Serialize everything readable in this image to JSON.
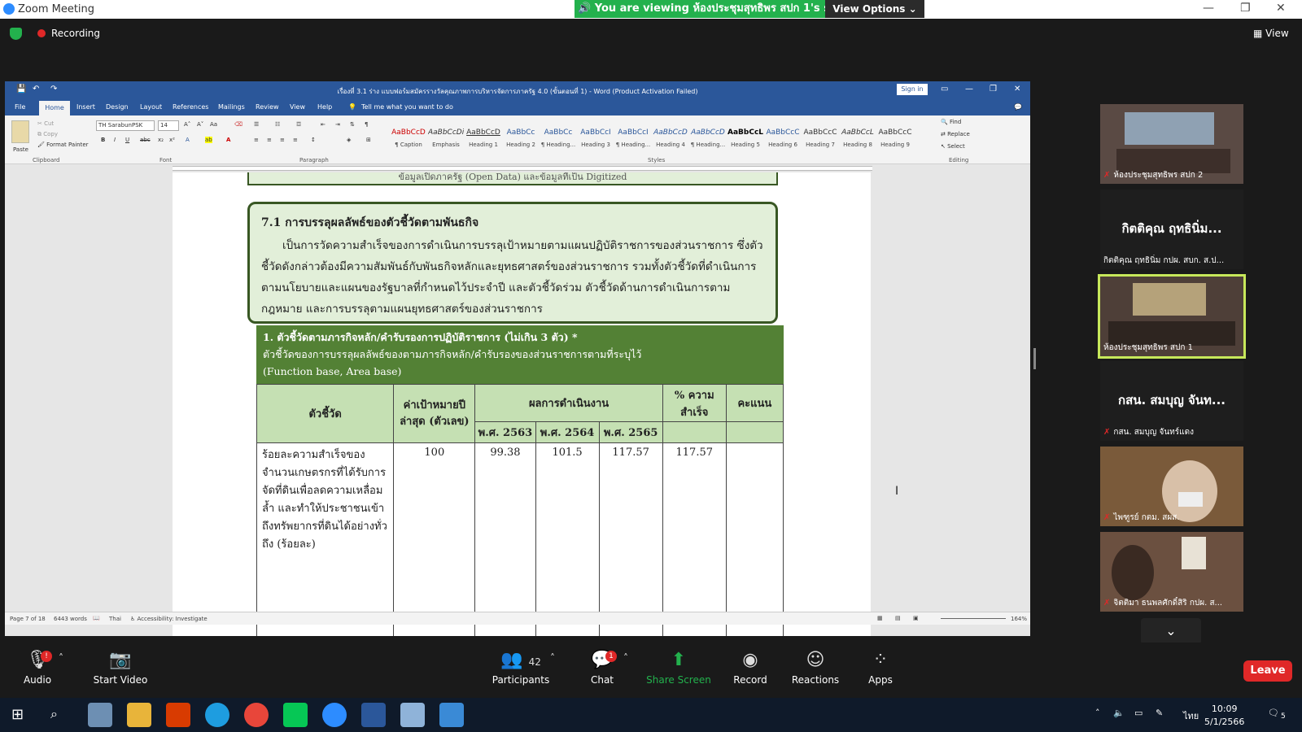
{
  "zoom": {
    "window_title": "Zoom Meeting",
    "viewing_banner": "You are viewing ห้องประชุมสุทธิพร สปก 1's screen",
    "view_options": "View Options",
    "recording": "Recording",
    "view_button": "View"
  },
  "word": {
    "title": "เรื่องที่ 3.1 ร่าง แบบฟอร์มสมัครรางวัลคุณภาพการบริหารจัดการภาครัฐ 4.0 (ขั้นตอนที่ 1) - Word (Product Activation Failed)",
    "sign_in": "Sign in",
    "tabs": [
      "File",
      "Home",
      "Insert",
      "Design",
      "Layout",
      "References",
      "Mailings",
      "Review",
      "View",
      "Help"
    ],
    "tell_me": "Tell me what you want to do",
    "clipboard": {
      "paste": "Paste",
      "cut": "Cut",
      "copy": "Copy",
      "format_painter": "Format Painter",
      "label": "Clipboard"
    },
    "font": {
      "name": "TH SarabunPSK",
      "size": "14",
      "label": "Font"
    },
    "paragraph_label": "Paragraph",
    "styles_label": "Styles",
    "styles": [
      {
        "sample": "AaBbCcD",
        "name": "¶ Caption"
      },
      {
        "sample": "AaBbCcDi",
        "name": "Emphasis"
      },
      {
        "sample": "AaBbCcD",
        "name": "Heading 1"
      },
      {
        "sample": "AaBbCc",
        "name": "Heading 2"
      },
      {
        "sample": "AaBbCc",
        "name": "¶ Heading..."
      },
      {
        "sample": "AaBbCcI",
        "name": "Heading 3"
      },
      {
        "sample": "AaBbCcI",
        "name": "¶ Heading..."
      },
      {
        "sample": "AaBbCcD",
        "name": "Heading 4"
      },
      {
        "sample": "AaBbCcD",
        "name": "¶ Heading..."
      },
      {
        "sample": "AaBbCcL",
        "name": "Heading 5"
      },
      {
        "sample": "AaBbCcC",
        "name": "Heading 6"
      },
      {
        "sample": "AaBbCcC",
        "name": "Heading 7"
      },
      {
        "sample": "AaBbCcL",
        "name": "Heading 8"
      },
      {
        "sample": "AaBbCcC",
        "name": "Heading 9"
      }
    ],
    "editing": {
      "find": "Find",
      "replace": "Replace",
      "select": "Select",
      "label": "Editing"
    },
    "status": {
      "page": "Page 7 of 18",
      "words": "6443 words",
      "lang": "Thai",
      "accessibility": "Accessibility: Investigate",
      "zoom": "164%"
    }
  },
  "doc": {
    "top_box_text": "ข้อมูลเปิดภาครัฐ (Open Data) และข้อมูลที่เป็น Digitized",
    "section_heading": "7.1 การบรรลุผลลัพธ์ของตัวชี้วัดตามพันธกิจ",
    "section_body": "เป็นการวัดความสำเร็จของการดำเนินการบรรลุเป้าหมายตามแผนปฏิบัติราชการของส่วนราชการ ซึ่งตัวชี้วัดดังกล่าวต้องมีความสัมพันธ์กับพันธกิจหลักและยุทธศาสตร์ของส่วนราชการ รวมทั้งตัวชี้วัดที่ดำเนินการตามนโยบายและแผนของรัฐบาลที่กำหนดไว้ประจำปี และตัวชี้วัดร่วม ตัวชี้วัดด้านการดำเนินการตามกฎหมาย และการบรรลุตามแผนยุทธศาสตร์ของส่วนราชการ",
    "green_title": "1. ตัวชี้วัดตามภารกิจหลัก/คำรับรองการปฏิบัติราชการ (ไม่เกิน 3 ตัว) *",
    "green_sub1": "ตัวชี้วัดของการบรรลุผลลัพธ์ของตามภารกิจหลัก/คำรับรองของส่วนราชการตามที่ระบุไว้",
    "green_sub2": "(Function base, Area base)",
    "table": {
      "col_indicator": "ตัวชี้วัด",
      "col_target": "ค่าเป้าหมายปีล่าสุด (ตัวเลข)",
      "col_results": "ผลการดำเนินงาน",
      "col_pct": "% ความสำเร็จ",
      "col_score": "คะแนน",
      "years": [
        "พ.ศ. 2563",
        "พ.ศ. 2564",
        "พ.ศ. 2565"
      ],
      "row": {
        "indicator": "ร้อยละความสำเร็จของจำนวนเกษตรกรที่ได้รับการจัดที่ดินเพื่อลดความเหลื่อมล้ำ และทำให้ประชาชนเข้าถึงทรัพยากรที่ดินได้อย่างทั่วถึง (ร้อยละ)",
        "target": "100",
        "y2563": "99.38",
        "y2564": "101.5",
        "y2565": "117.57",
        "pct": "117.57",
        "score": ""
      }
    }
  },
  "participants": [
    {
      "name": "ห้องประชุมสุทธิพร สปก 2",
      "video": true
    },
    {
      "name": "กิตติคุณ ฤทธินิ่ม กปผ. สบก. ส.ป...",
      "big": "กิตติคุณ ฤทธินิ่ม...",
      "video": false
    },
    {
      "name": "ห้องประชุมสุทธิพร สปก 1",
      "video": true,
      "active": true
    },
    {
      "name": "กสน. สมบุญ  จันทร์แดง",
      "big": "กสน. สมบุญ  จันท...",
      "video": false
    },
    {
      "name": "ไพฑูรย์  กตม. สผส.",
      "video": true
    },
    {
      "name": "จิตติมา ธนพลศักดิ์สิริ  กปผ. ส...",
      "video": true
    }
  ],
  "toolbar": {
    "audio": "Audio",
    "start_video": "Start Video",
    "participants": "Participants",
    "participants_count": "42",
    "chat": "Chat",
    "chat_badge": "1",
    "audio_badge": "!",
    "share": "Share Screen",
    "record": "Record",
    "reactions": "Reactions",
    "apps": "Apps",
    "leave": "Leave"
  },
  "taskbar": {
    "time": "10:09",
    "date": "5/1/2566",
    "lang": "ไทย",
    "notif": "5"
  }
}
